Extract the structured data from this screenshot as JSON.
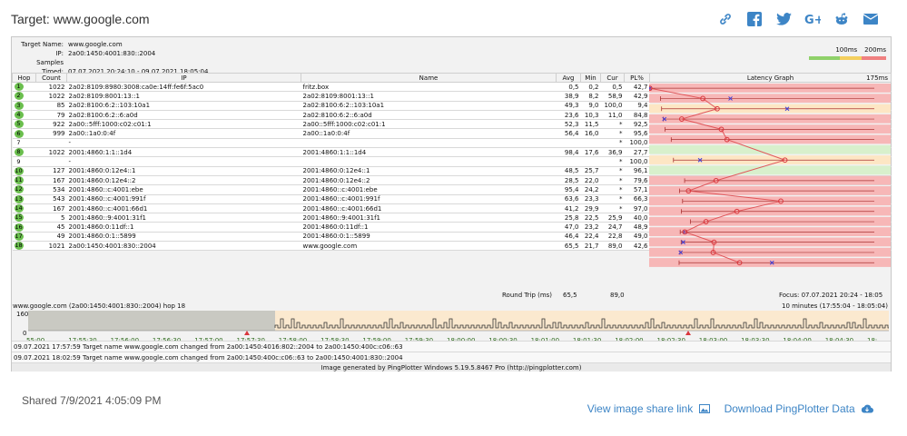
{
  "header": {
    "title": "Target: www.google.com"
  },
  "share_icons": [
    "link-icon",
    "facebook-icon",
    "twitter-icon",
    "googleplus-icon",
    "reddit-icon",
    "email-icon"
  ],
  "meta": {
    "target_label": "Target Name:",
    "target_value": "www.google.com",
    "ip_label": "IP:",
    "ip_value": "2a00:1450:4001:830::2004",
    "samples_label": "Samples Timed:",
    "samples_value": "07.07.2021 20:24:10 - 09.07.2021 18:05:04"
  },
  "scale": {
    "a": "100ms",
    "b": "200ms"
  },
  "columns": {
    "hop": "Hop",
    "count": "Count",
    "ip": "IP",
    "name": "Name",
    "avg": "Avg",
    "min": "Min",
    "cur": "Cur",
    "pl": "PL%",
    "graph": "Latency Graph",
    "graph_max": "175ms"
  },
  "hops": [
    {
      "hop": "1",
      "count": "1022",
      "ip": "2a02:8109:8980:3008:ca0e:14ff:fe6f:5ac0",
      "name": "fritz.box",
      "avg": "0,5",
      "min": "0,2",
      "cur": "0,5",
      "pl": "42,7"
    },
    {
      "hop": "2",
      "count": "1022",
      "ip": "2a02:8109:8001:13::1",
      "name": "2a02:8109:8001:13::1",
      "avg": "38,9",
      "min": "8,2",
      "cur": "58,9",
      "pl": "42,9"
    },
    {
      "hop": "3",
      "count": "85",
      "ip": "2a02:8100:6:2::103:10a1",
      "name": "2a02:8100:6:2::103:10a1",
      "avg": "49,3",
      "min": "9,0",
      "cur": "100,0",
      "pl": "9,4"
    },
    {
      "hop": "4",
      "count": "79",
      "ip": "2a02:8100:6:2::6:a0d",
      "name": "2a02:8100:6:2::6:a0d",
      "avg": "23,6",
      "min": "10,3",
      "cur": "11,0",
      "pl": "84,8"
    },
    {
      "hop": "5",
      "count": "922",
      "ip": "2a00::5fff:1000:c02:c01:1",
      "name": "2a00::5fff:1000:c02:c01:1",
      "avg": "52,3",
      "min": "11,5",
      "cur": "*",
      "pl": "92,5"
    },
    {
      "hop": "6",
      "count": "999",
      "ip": "2a00::1a0:0:4f",
      "name": "2a00::1a0:0:4f",
      "avg": "56,4",
      "min": "16,0",
      "cur": "*",
      "pl": "95,6"
    },
    {
      "hop": "7",
      "count": "",
      "ip": "-",
      "name": "",
      "avg": "",
      "min": "",
      "cur": "*",
      "pl": "100,0"
    },
    {
      "hop": "8",
      "count": "1022",
      "ip": "2001:4860:1:1::1d4",
      "name": "2001:4860:1:1::1d4",
      "avg": "98,4",
      "min": "17,6",
      "cur": "36,9",
      "pl": "27,7"
    },
    {
      "hop": "9",
      "count": "",
      "ip": "-",
      "name": "",
      "avg": "",
      "min": "",
      "cur": "*",
      "pl": "100,0"
    },
    {
      "hop": "10",
      "count": "127",
      "ip": "2001:4860:0:12e4::1",
      "name": "2001:4860:0:12e4::1",
      "avg": "48,5",
      "min": "25,7",
      "cur": "*",
      "pl": "96,1"
    },
    {
      "hop": "11",
      "count": "167",
      "ip": "2001:4860:0:12e4::2",
      "name": "2001:4860:0:12e4::2",
      "avg": "28,5",
      "min": "22,0",
      "cur": "*",
      "pl": "79,6"
    },
    {
      "hop": "12",
      "count": "534",
      "ip": "2001:4860::c:4001:ebe",
      "name": "2001:4860::c:4001:ebe",
      "avg": "95,4",
      "min": "24,2",
      "cur": "*",
      "pl": "57,1"
    },
    {
      "hop": "13",
      "count": "543",
      "ip": "2001:4860::c:4001:991f",
      "name": "2001:4860::c:4001:991f",
      "avg": "63,6",
      "min": "23,3",
      "cur": "*",
      "pl": "66,3"
    },
    {
      "hop": "14",
      "count": "167",
      "ip": "2001:4860::c:4001:66d1",
      "name": "2001:4860::c:4001:66d1",
      "avg": "41,2",
      "min": "29,9",
      "cur": "*",
      "pl": "97,0"
    },
    {
      "hop": "15",
      "count": "5",
      "ip": "2001:4860::9:4001:31f1",
      "name": "2001:4860::9:4001:31f1",
      "avg": "25,8",
      "min": "22,5",
      "cur": "25,9",
      "pl": "40,0"
    },
    {
      "hop": "16",
      "count": "45",
      "ip": "2001:4860:0:11df::1",
      "name": "2001:4860:0:11df::1",
      "avg": "47,0",
      "min": "23,2",
      "cur": "24,7",
      "pl": "48,9"
    },
    {
      "hop": "17",
      "count": "49",
      "ip": "2001:4860:0:1::5899",
      "name": "2001:4860:0:1::5899",
      "avg": "46,4",
      "min": "22,4",
      "cur": "22,8",
      "pl": "49,0"
    },
    {
      "hop": "18",
      "count": "1021",
      "ip": "2a00:1450:4001:830::2004",
      "name": "www.google.com",
      "avg": "65,5",
      "min": "21,7",
      "cur": "89,0",
      "pl": "42,6"
    }
  ],
  "round_trip": {
    "label": "Round Trip (ms)",
    "avg": "65,5",
    "cur": "89,0",
    "focus": "Focus: 07.07.2021 20:24 - 18:05"
  },
  "timeline": {
    "label": "www.google.com (2a00:1450:4001:830::2004) hop 18",
    "range": "10 minutes (17:55:04 - 18:05:04)",
    "y_top": "160",
    "y_bottom": "0",
    "corner_value": "30",
    "ticks": [
      "55:00",
      "17:55:30",
      "17:56:00",
      "17:56:30",
      "17:57:00",
      "17:57:30",
      "17:58:00",
      "17:58:30",
      "17:59:00",
      "17:59:30",
      "18:00:00",
      "18:00:30",
      "18:01:00",
      "18:01:30",
      "18:02:00",
      "18:02:30",
      "18:03:00",
      "18:03:30",
      "18:04:00",
      "18:04:30",
      "18:"
    ]
  },
  "events": [
    "09.07.2021 17:57:59 Target name www.google.com changed from 2a00:1450:4016:802::2004 to 2a00:1450:400c:c06::63",
    "09.07.2021 18:02:59 Target name www.google.com changed from 2a00:1450:400c:c06::63 to 2a00:1450:4001:830::2004"
  ],
  "generated": "Image generated by PingPlotter Windows 5.19.5.8467 Pro (http://pingplotter.com)",
  "footer": {
    "shared": "Shared 7/9/2021 4:05:09 PM",
    "share_link": "View image share link",
    "download": "Download PingPlotter Data"
  },
  "colors": {
    "green": "#6bbf4e",
    "red_bg": "#f7b7b7",
    "orange_bg": "#fde6c4",
    "green_bg": "#d8f0cc",
    "link": "#3d85c6"
  }
}
